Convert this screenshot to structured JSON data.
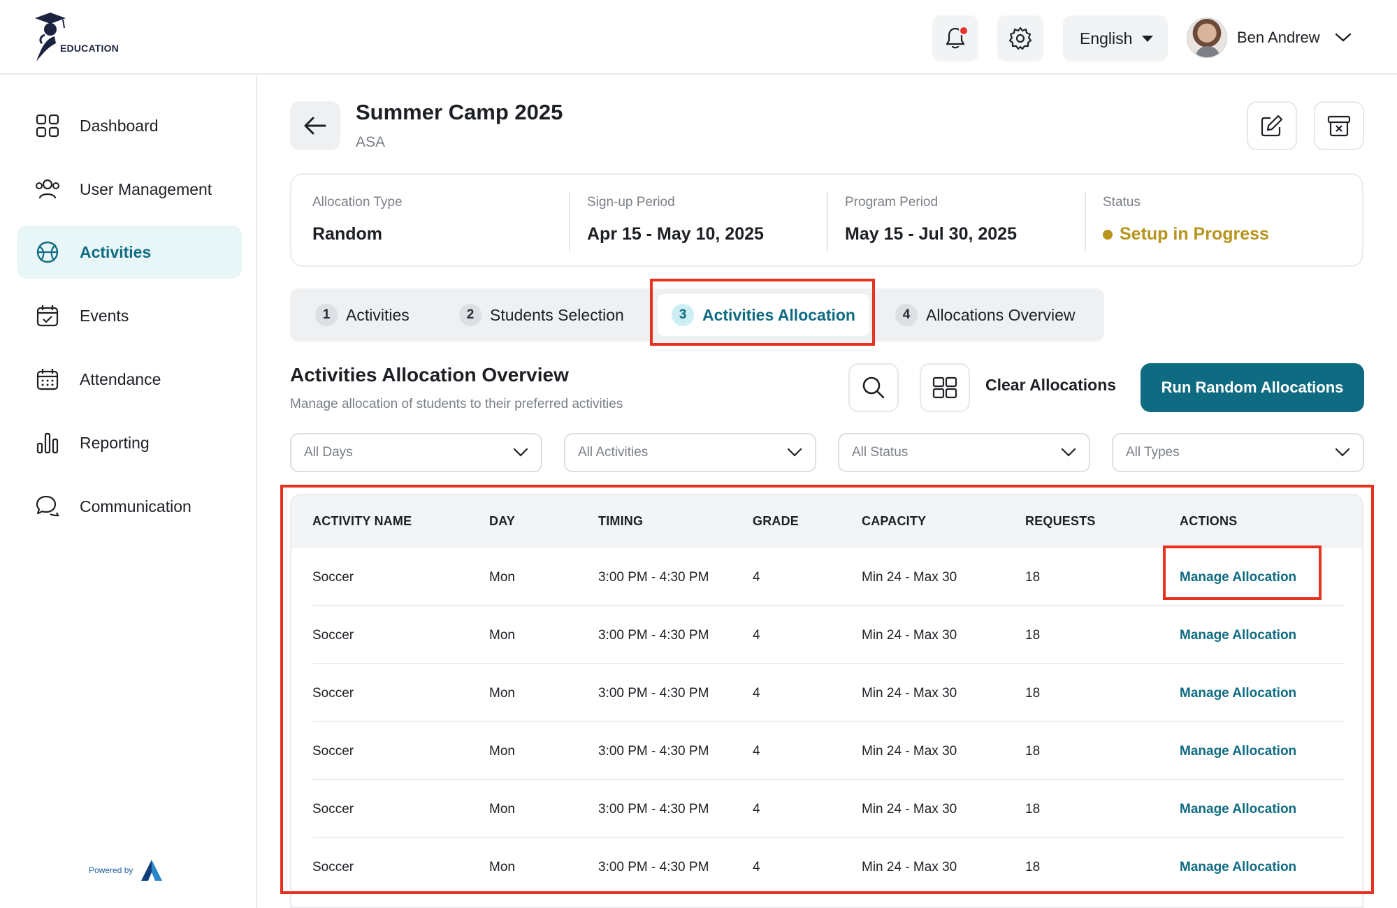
{
  "brand": {
    "logo_text": "EDUCATION",
    "powered_by": "Powered by"
  },
  "header": {
    "language": "English",
    "user_name": "Ben Andrew"
  },
  "sidebar": {
    "items": [
      {
        "label": "Dashboard",
        "icon": "dashboard-icon"
      },
      {
        "label": "User Management",
        "icon": "users-icon"
      },
      {
        "label": "Activities",
        "icon": "activities-icon",
        "active": true
      },
      {
        "label": "Events",
        "icon": "calendar-check-icon"
      },
      {
        "label": "Attendance",
        "icon": "calendar-icon"
      },
      {
        "label": "Reporting",
        "icon": "bar-chart-icon"
      },
      {
        "label": "Communication",
        "icon": "chat-icon"
      }
    ]
  },
  "page": {
    "title": "Summer Camp 2025",
    "subtitle": "ASA"
  },
  "info": {
    "allocation_type": {
      "label": "Allocation Type",
      "value": "Random"
    },
    "signup_period": {
      "label": "Sign-up Period",
      "value": "Apr 15 - May 10, 2025"
    },
    "program_period": {
      "label": "Program Period",
      "value": "May 15 - Jul 30, 2025"
    },
    "status": {
      "label": "Status",
      "value": "Setup in Progress",
      "color": "#b7941c"
    }
  },
  "tabs": [
    {
      "num": "1",
      "label": "Activities"
    },
    {
      "num": "2",
      "label": "Students Selection"
    },
    {
      "num": "3",
      "label": "Activities Allocation",
      "active": true
    },
    {
      "num": "4",
      "label": "Allocations Overview"
    }
  ],
  "section": {
    "title": "Activities Allocation Overview",
    "subtitle": "Manage allocation of students to their preferred activities",
    "clear_label": "Clear Allocations",
    "run_label": "Run Random Allocations"
  },
  "filters": [
    "All Days",
    "All Activities",
    "All Status",
    "All Types"
  ],
  "table": {
    "headers": [
      "ACTIVITY NAME",
      "DAY",
      "TIMING",
      "GRADE",
      "CAPACITY",
      "REQUESTS",
      "ACTIONS"
    ],
    "rows": [
      [
        "Soccer",
        "Mon",
        "3:00 PM - 4:30 PM",
        "4",
        "Min 24 - Max 30",
        "18",
        "Manage Allocation"
      ],
      [
        "Soccer",
        "Mon",
        "3:00 PM - 4:30 PM",
        "4",
        "Min 24 - Max 30",
        "18",
        "Manage Allocation"
      ],
      [
        "Soccer",
        "Mon",
        "3:00 PM - 4:30 PM",
        "4",
        "Min 24 - Max 30",
        "18",
        "Manage Allocation"
      ],
      [
        "Soccer",
        "Mon",
        "3:00 PM - 4:30 PM",
        "4",
        "Min 24 - Max 30",
        "18",
        "Manage Allocation"
      ],
      [
        "Soccer",
        "Mon",
        "3:00 PM - 4:30 PM",
        "4",
        "Min 24 - Max 30",
        "18",
        "Manage Allocation"
      ],
      [
        "Soccer",
        "Mon",
        "3:00 PM - 4:30 PM",
        "4",
        "Min 24 - Max 30",
        "18",
        "Manage Allocation"
      ]
    ]
  },
  "colors": {
    "accent": "#0f6b82",
    "highlight": "#e8321f"
  }
}
